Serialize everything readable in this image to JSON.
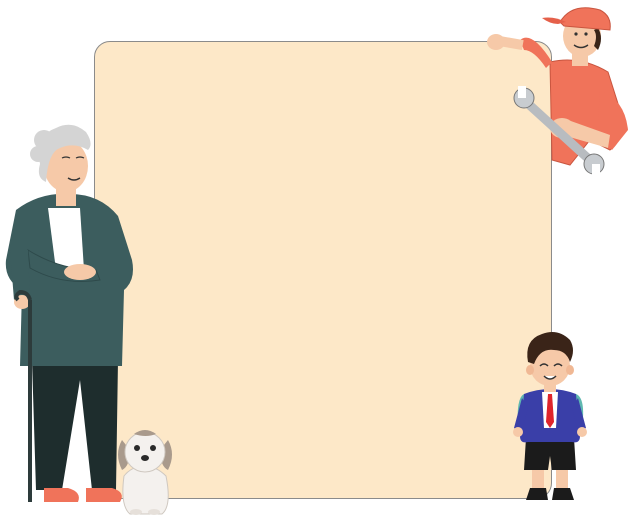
{
  "scene": {
    "board": {
      "fill_color": "#fde8c8",
      "border_color": "#8b8b8b"
    },
    "characters": [
      {
        "id": "grandmother",
        "icon": "elderly-woman-with-cane"
      },
      {
        "id": "dog",
        "icon": "shih-tzu-dog"
      },
      {
        "id": "mechanic",
        "icon": "mechanic-with-wrench"
      },
      {
        "id": "schoolboy",
        "icon": "schoolboy-with-backpack"
      }
    ],
    "colors": {
      "cardigan": "#3c5d5e",
      "trousers": "#1e2d2d",
      "shirt_orange": "#f0735a",
      "blazer": "#3a3fa8",
      "backpack": "#5fb8b0",
      "skin": "#f6c9a8",
      "hair_grey": "#d4d4d4",
      "hair_dark": "#3a2418"
    }
  }
}
